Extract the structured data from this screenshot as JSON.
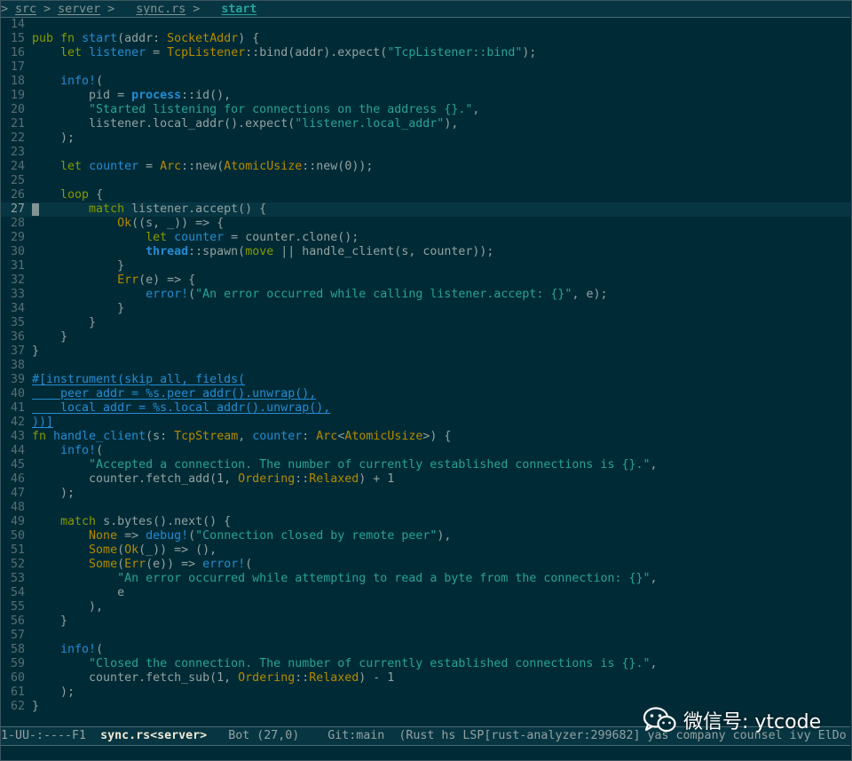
{
  "breadcrumb": {
    "lead": ">",
    "segments": [
      "src",
      "server",
      "sync.rs"
    ],
    "separator": ">",
    "current": "start"
  },
  "editor": {
    "current_line": 27,
    "lines": [
      {
        "n": 14,
        "tokens": []
      },
      {
        "n": 15,
        "tokens": [
          [
            "k",
            "pub "
          ],
          [
            "k",
            "fn "
          ],
          [
            "f",
            "start"
          ],
          [
            "p",
            "("
          ],
          [
            "n",
            "addr"
          ],
          [
            "p",
            ": "
          ],
          [
            "t",
            "SocketAddr"
          ],
          [
            "p",
            ") {"
          ]
        ]
      },
      {
        "n": 16,
        "tokens": [
          [
            "p",
            "    "
          ],
          [
            "k",
            "let "
          ],
          [
            "v",
            "listener"
          ],
          [
            "p",
            " = "
          ],
          [
            "t",
            "TcpListener"
          ],
          [
            "p",
            "::bind(addr).expect("
          ],
          [
            "s",
            "\"TcpListener::bind\""
          ],
          [
            "p",
            ");"
          ]
        ]
      },
      {
        "n": 17,
        "tokens": []
      },
      {
        "n": 18,
        "tokens": [
          [
            "p",
            "    "
          ],
          [
            "m",
            "info!"
          ],
          [
            "p",
            "("
          ]
        ]
      },
      {
        "n": 19,
        "tokens": [
          [
            "p",
            "        pid = "
          ],
          [
            "b",
            "process"
          ],
          [
            "p",
            "::id(),"
          ]
        ]
      },
      {
        "n": 20,
        "tokens": [
          [
            "p",
            "        "
          ],
          [
            "s",
            "\"Started listening for connections on the address {}.\""
          ],
          [
            "p",
            ","
          ]
        ]
      },
      {
        "n": 21,
        "tokens": [
          [
            "p",
            "        listener.local_addr().expect("
          ],
          [
            "s",
            "\"listener.local_addr\""
          ],
          [
            "p",
            "),"
          ]
        ]
      },
      {
        "n": 22,
        "tokens": [
          [
            "p",
            "    );"
          ]
        ]
      },
      {
        "n": 23,
        "tokens": []
      },
      {
        "n": 24,
        "tokens": [
          [
            "p",
            "    "
          ],
          [
            "k",
            "let "
          ],
          [
            "v",
            "counter"
          ],
          [
            "p",
            " = "
          ],
          [
            "t",
            "Arc"
          ],
          [
            "p",
            "::new("
          ],
          [
            "t",
            "AtomicUsize"
          ],
          [
            "p",
            "::new(0));"
          ]
        ]
      },
      {
        "n": 25,
        "tokens": []
      },
      {
        "n": 26,
        "tokens": [
          [
            "p",
            "    "
          ],
          [
            "k",
            "loop"
          ],
          [
            "p",
            " {"
          ]
        ]
      },
      {
        "n": 27,
        "tokens": [
          [
            "p",
            "        "
          ],
          [
            "k",
            "match"
          ],
          [
            "p",
            " listener.accept() {"
          ]
        ]
      },
      {
        "n": 28,
        "tokens": [
          [
            "p",
            "            "
          ],
          [
            "t",
            "Ok"
          ],
          [
            "p",
            "((s, _)) => {"
          ]
        ]
      },
      {
        "n": 29,
        "tokens": [
          [
            "p",
            "                "
          ],
          [
            "k",
            "let "
          ],
          [
            "v",
            "counter"
          ],
          [
            "p",
            " = counter.clone();"
          ]
        ]
      },
      {
        "n": 30,
        "tokens": [
          [
            "p",
            "                "
          ],
          [
            "b",
            "thread"
          ],
          [
            "p",
            "::spawn("
          ],
          [
            "k",
            "move"
          ],
          [
            "p",
            " || handle_client(s, counter));"
          ]
        ]
      },
      {
        "n": 31,
        "tokens": [
          [
            "p",
            "            }"
          ]
        ]
      },
      {
        "n": 32,
        "tokens": [
          [
            "p",
            "            "
          ],
          [
            "t",
            "Err"
          ],
          [
            "p",
            "(e) => {"
          ]
        ]
      },
      {
        "n": 33,
        "tokens": [
          [
            "p",
            "                "
          ],
          [
            "m",
            "error!"
          ],
          [
            "p",
            "("
          ],
          [
            "s",
            "\"An error occurred while calling listener.accept: {}\""
          ],
          [
            "p",
            ", e);"
          ]
        ]
      },
      {
        "n": 34,
        "tokens": [
          [
            "p",
            "            }"
          ]
        ]
      },
      {
        "n": 35,
        "tokens": [
          [
            "p",
            "        }"
          ]
        ]
      },
      {
        "n": 36,
        "tokens": [
          [
            "p",
            "    }"
          ]
        ]
      },
      {
        "n": 37,
        "tokens": [
          [
            "p",
            "}"
          ]
        ]
      },
      {
        "n": 38,
        "tokens": []
      },
      {
        "n": 39,
        "tokens": [
          [
            "f",
            "#[instrument(skip_all, fields("
          ]
        ]
      },
      {
        "n": 40,
        "tokens": [
          [
            "f",
            "    peer_addr = %s.peer_addr().unwrap(),"
          ]
        ]
      },
      {
        "n": 41,
        "tokens": [
          [
            "f",
            "    local_addr = %s.local_addr().unwrap(),"
          ]
        ]
      },
      {
        "n": 42,
        "tokens": [
          [
            "f",
            "))]"
          ]
        ]
      },
      {
        "n": 43,
        "tokens": [
          [
            "k",
            "fn "
          ],
          [
            "f",
            "handle_client"
          ],
          [
            "p",
            "("
          ],
          [
            "n",
            "s"
          ],
          [
            "p",
            ": "
          ],
          [
            "t",
            "TcpStream"
          ],
          [
            "p",
            ", "
          ],
          [
            "v",
            "counter"
          ],
          [
            "p",
            ": "
          ],
          [
            "t",
            "Arc"
          ],
          [
            "p",
            "<"
          ],
          [
            "t",
            "AtomicUsize"
          ],
          [
            "p",
            ">) {"
          ]
        ]
      },
      {
        "n": 44,
        "tokens": [
          [
            "p",
            "    "
          ],
          [
            "m",
            "info!"
          ],
          [
            "p",
            "("
          ]
        ]
      },
      {
        "n": 45,
        "tokens": [
          [
            "p",
            "        "
          ],
          [
            "s",
            "\"Accepted a connection. The number of currently established connections is {}.\""
          ],
          [
            "p",
            ","
          ]
        ]
      },
      {
        "n": 46,
        "tokens": [
          [
            "p",
            "        counter.fetch_add(1, "
          ],
          [
            "t",
            "Ordering"
          ],
          [
            "p",
            "::"
          ],
          [
            "t",
            "Relaxed"
          ],
          [
            "p",
            ") + 1"
          ]
        ]
      },
      {
        "n": 47,
        "tokens": [
          [
            "p",
            "    );"
          ]
        ]
      },
      {
        "n": 48,
        "tokens": []
      },
      {
        "n": 49,
        "tokens": [
          [
            "p",
            "    "
          ],
          [
            "k",
            "match"
          ],
          [
            "p",
            " s.bytes().next() {"
          ]
        ]
      },
      {
        "n": 50,
        "tokens": [
          [
            "p",
            "        "
          ],
          [
            "t",
            "None"
          ],
          [
            "p",
            " => "
          ],
          [
            "m",
            "debug!"
          ],
          [
            "p",
            "("
          ],
          [
            "s",
            "\"Connection closed by remote peer\""
          ],
          [
            "p",
            "),"
          ]
        ]
      },
      {
        "n": 51,
        "tokens": [
          [
            "p",
            "        "
          ],
          [
            "t",
            "Some"
          ],
          [
            "p",
            "("
          ],
          [
            "t",
            "Ok"
          ],
          [
            "p",
            "(_)) => (),"
          ]
        ]
      },
      {
        "n": 52,
        "tokens": [
          [
            "p",
            "        "
          ],
          [
            "t",
            "Some"
          ],
          [
            "p",
            "("
          ],
          [
            "t",
            "Err"
          ],
          [
            "p",
            "(e)) => "
          ],
          [
            "m",
            "error!"
          ],
          [
            "p",
            "("
          ]
        ]
      },
      {
        "n": 53,
        "tokens": [
          [
            "p",
            "            "
          ],
          [
            "s",
            "\"An error occurred while attempting to read a byte from the connection: {}\""
          ],
          [
            "p",
            ","
          ]
        ]
      },
      {
        "n": 54,
        "tokens": [
          [
            "p",
            "            e"
          ]
        ]
      },
      {
        "n": 55,
        "tokens": [
          [
            "p",
            "        ),"
          ]
        ]
      },
      {
        "n": 56,
        "tokens": [
          [
            "p",
            "    }"
          ]
        ]
      },
      {
        "n": 57,
        "tokens": []
      },
      {
        "n": 58,
        "tokens": [
          [
            "p",
            "    "
          ],
          [
            "m",
            "info!"
          ],
          [
            "p",
            "("
          ]
        ]
      },
      {
        "n": 59,
        "tokens": [
          [
            "p",
            "        "
          ],
          [
            "s",
            "\"Closed the connection. The number of currently established connections is {}.\""
          ],
          [
            "p",
            ","
          ]
        ]
      },
      {
        "n": 60,
        "tokens": [
          [
            "p",
            "        counter.fetch_sub(1, "
          ],
          [
            "t",
            "Ordering"
          ],
          [
            "p",
            "::"
          ],
          [
            "t",
            "Relaxed"
          ],
          [
            "p",
            ") - 1"
          ]
        ]
      },
      {
        "n": 61,
        "tokens": [
          [
            "p",
            "    );"
          ]
        ]
      },
      {
        "n": 62,
        "tokens": [
          [
            "p",
            "}"
          ]
        ]
      }
    ]
  },
  "modeline": {
    "status": "1-UU-:----F1  ",
    "buffer": "sync.rs<server>",
    "position": "   Bot (27,0)    ",
    "vc": "Git:main  ",
    "modes": "(Rust hs LSP[rust-analyzer:299682] yas company counsel ivy ElDo"
  },
  "watermark": {
    "text": "微信号: ytcode",
    "icon": "wechat-icon"
  },
  "colors": {
    "background": "#002b36",
    "keyword": "#859900",
    "function": "#268bd2",
    "type": "#b58900",
    "string": "#2aa198"
  }
}
